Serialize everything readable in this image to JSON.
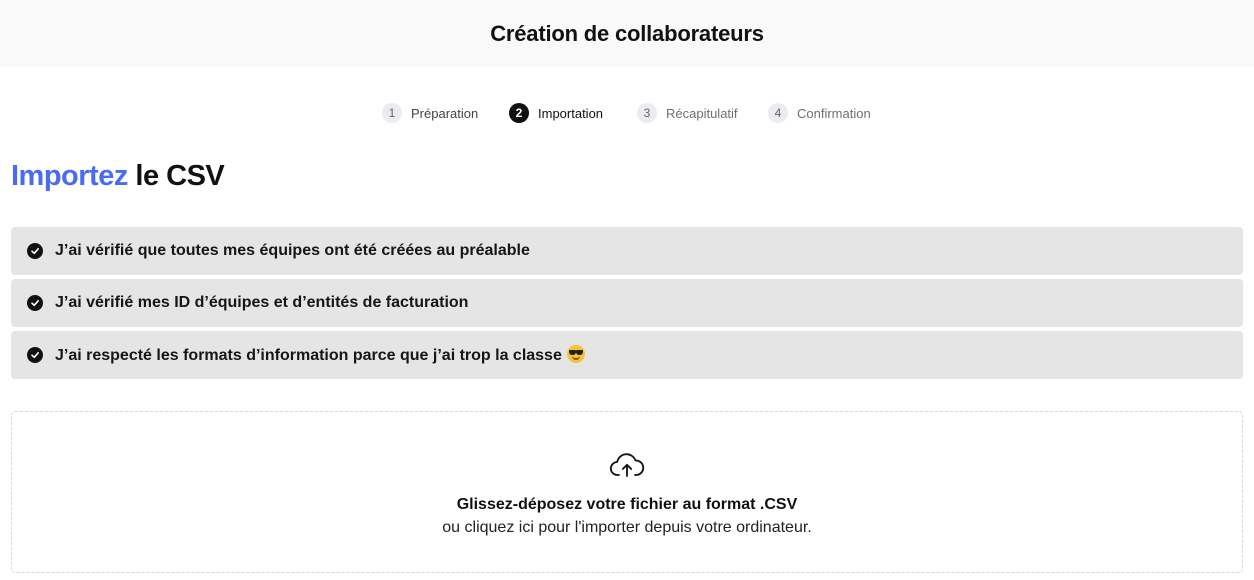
{
  "header": {
    "title": "Création de collaborateurs"
  },
  "stepper": {
    "steps": [
      {
        "number": "1",
        "label": "Préparation",
        "state": "done"
      },
      {
        "number": "2",
        "label": "Importation",
        "state": "active"
      },
      {
        "number": "3",
        "label": "Récapitulatif",
        "state": "upcoming"
      },
      {
        "number": "4",
        "label": "Confirmation",
        "state": "upcoming"
      }
    ]
  },
  "main": {
    "title_accent": "Importez",
    "title_rest": "le CSV",
    "checklist": [
      {
        "label": "J’ai vérifié que toutes mes équipes ont été créées au préalable",
        "checked": true
      },
      {
        "label": "J’ai vérifié mes ID d’équipes et d’entités de facturation",
        "checked": true
      },
      {
        "label": "J’ai respecté les formats d’information parce que j’ai trop la classe",
        "checked": true,
        "emoji": "smiling-face-with-sunglasses"
      }
    ],
    "dropzone": {
      "icon": "cloud-upload-icon",
      "main_text": "Glissez-déposez votre fichier au format .CSV",
      "sub_text": "ou cliquez ici pour l'importer depuis votre ordinateur."
    }
  },
  "colors": {
    "accent": "#4a6cf0",
    "header_bg": "#f9f9f9",
    "checklist_bg": "#e5e5e5",
    "active_step": "#111111"
  }
}
